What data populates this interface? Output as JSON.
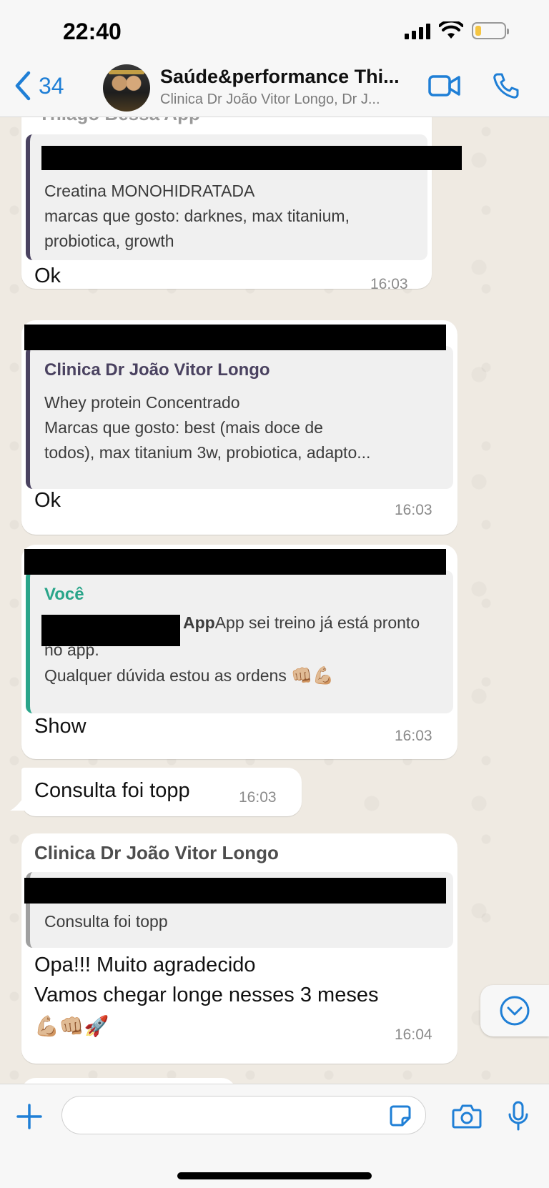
{
  "status_bar": {
    "time": "22:40"
  },
  "header": {
    "back_count": "34",
    "title": "Saúde&performance Thi...",
    "subtitle": "Clinica Dr João Vitor Longo, Dr J..."
  },
  "messages": [
    {
      "partial_sender": "Thiago Bessa App",
      "quote_lines": [
        "Creatina MONOHIDRATADA",
        "marcas que gosto: darknes, max titanium,",
        "probiotica, growth"
      ],
      "text": "Ok",
      "time": "16:03"
    },
    {
      "quote_sender": "Clinica Dr João Vitor Longo",
      "quote_lines": [
        "Whey protein Concentrado",
        "Marcas que gosto: best (mais doce de",
        "todos), max titanium 3w, probiotica, adapto..."
      ],
      "text": "Ok",
      "time": "16:03"
    },
    {
      "quote_sender": "Você",
      "quote_line1_suffix": "App  sei treino já está pronto",
      "quote_line2": "no app.",
      "quote_line3": "Qualquer dúvida estou as ordens",
      "quote_emojis": "👊🏼💪🏼",
      "text": "Show",
      "time": "16:03"
    },
    {
      "text": "Consulta foi topp",
      "time": "16:03"
    },
    {
      "sender": "Clinica Dr João Vitor Longo",
      "quote_lines": [
        "Consulta foi topp"
      ],
      "text_line1": "Opa!!! Muito agradecido",
      "text_line2": "Vamos chegar longe nesses 3 meses",
      "emojis": "💪🏼👊🏼🚀",
      "time": "16:04"
    }
  ],
  "input": {
    "placeholder": ""
  },
  "icons": {
    "back": "chevron-left-icon",
    "video": "video-camera-icon",
    "call": "phone-icon",
    "plus": "plus-icon",
    "sticker": "sticker-icon",
    "camera": "camera-icon",
    "mic": "microphone-icon",
    "scroll": "chevron-down-circle-icon"
  },
  "colors": {
    "accent": "#1f7fd6",
    "you_quote": "#2aa58a",
    "other_quote": "#4a4260",
    "background": "#efeae2"
  }
}
